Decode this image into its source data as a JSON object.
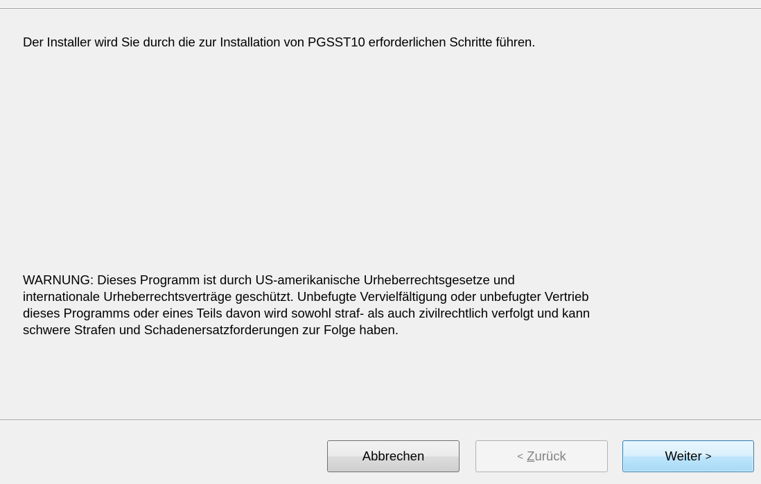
{
  "intro_text": "Der Installer wird Sie durch die zur Installation von PGSST10 erforderlichen Schritte führen.",
  "warning_lines": [
    "WARNUNG: Dieses Programm ist durch US-amerikanische Urheberrechtsgesetze und",
    "internationale Urheberrechtsverträge geschützt. Unbefugte Vervielfältigung oder unbefugter Vertrieb",
    "dieses Programms oder eines Teils davon wird sowohl straf- als auch zivilrechtlich verfolgt und kann",
    "schwere Strafen und Schadenersatzforderungen zur Folge haben."
  ],
  "buttons": {
    "cancel_label": "Abbrechen",
    "back_arrow": "<",
    "back_mnemonic": "Z",
    "back_rest": "urück",
    "back_enabled": false,
    "next_label": "Weiter",
    "next_arrow": ">",
    "next_focused": true
  }
}
